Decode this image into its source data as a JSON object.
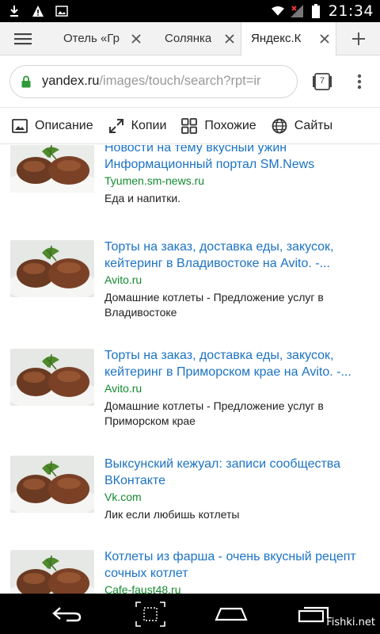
{
  "status_bar": {
    "time": "21:34",
    "left_icons": [
      "download-icon",
      "warning-icon",
      "image-icon"
    ],
    "right_icons": [
      "wifi-icon",
      "signal-icon",
      "battery-icon"
    ]
  },
  "tabs": [
    {
      "label": "Отель «Гр",
      "active": false
    },
    {
      "label": "Солянка",
      "active": false
    },
    {
      "label": "Яндекс.К",
      "active": true
    }
  ],
  "address_bar": {
    "host": "yandex.ru",
    "path": "/images/touch/search?rpt=ir",
    "tab_count": "7"
  },
  "image_tools": [
    {
      "label": "Описание",
      "icon": "image-icon"
    },
    {
      "label": "Копии",
      "icon": "expand-icon"
    },
    {
      "label": "Похожие",
      "icon": "grid-icon"
    },
    {
      "label": "Сайты",
      "icon": "globe-icon"
    }
  ],
  "results": [
    {
      "title": "Новости на тему вкусный ужин Информационный портал SM.News",
      "site": "Tyumen.sm-news.ru",
      "desc": "Еда и напитки."
    },
    {
      "title": "Торты на заказ, доставка еды, закусок, кейтеринг в Владивостоке на Avito. -...",
      "site": "Avito.ru",
      "desc": "Домашние котлеты - Предложение услуг в Владивостоке"
    },
    {
      "title": "Торты на заказ, доставка еды, закусок, кейтеринг в Приморском крае на Avito. -...",
      "site": "Avito.ru",
      "desc": "Домашние котлеты - Предложение услуг в Приморском крае"
    },
    {
      "title": "Выксунский кежуал: записи сообщества ВКонтакте",
      "site": "Vk.com",
      "desc": "Лик если любишь котлеты"
    },
    {
      "title": "Котлеты из фарша - очень вкусный рецепт сочных котлет",
      "site": "Cafe-faust48.ru",
      "desc": ""
    }
  ],
  "nav_bar": {
    "buttons": [
      "back-icon",
      "screenshot-icon",
      "home-icon",
      "recents-icon"
    ]
  },
  "watermark": "Fishki.net",
  "colors": {
    "link": "#1c73c4",
    "site": "#138a2e",
    "lock": "#2e9a3a"
  }
}
